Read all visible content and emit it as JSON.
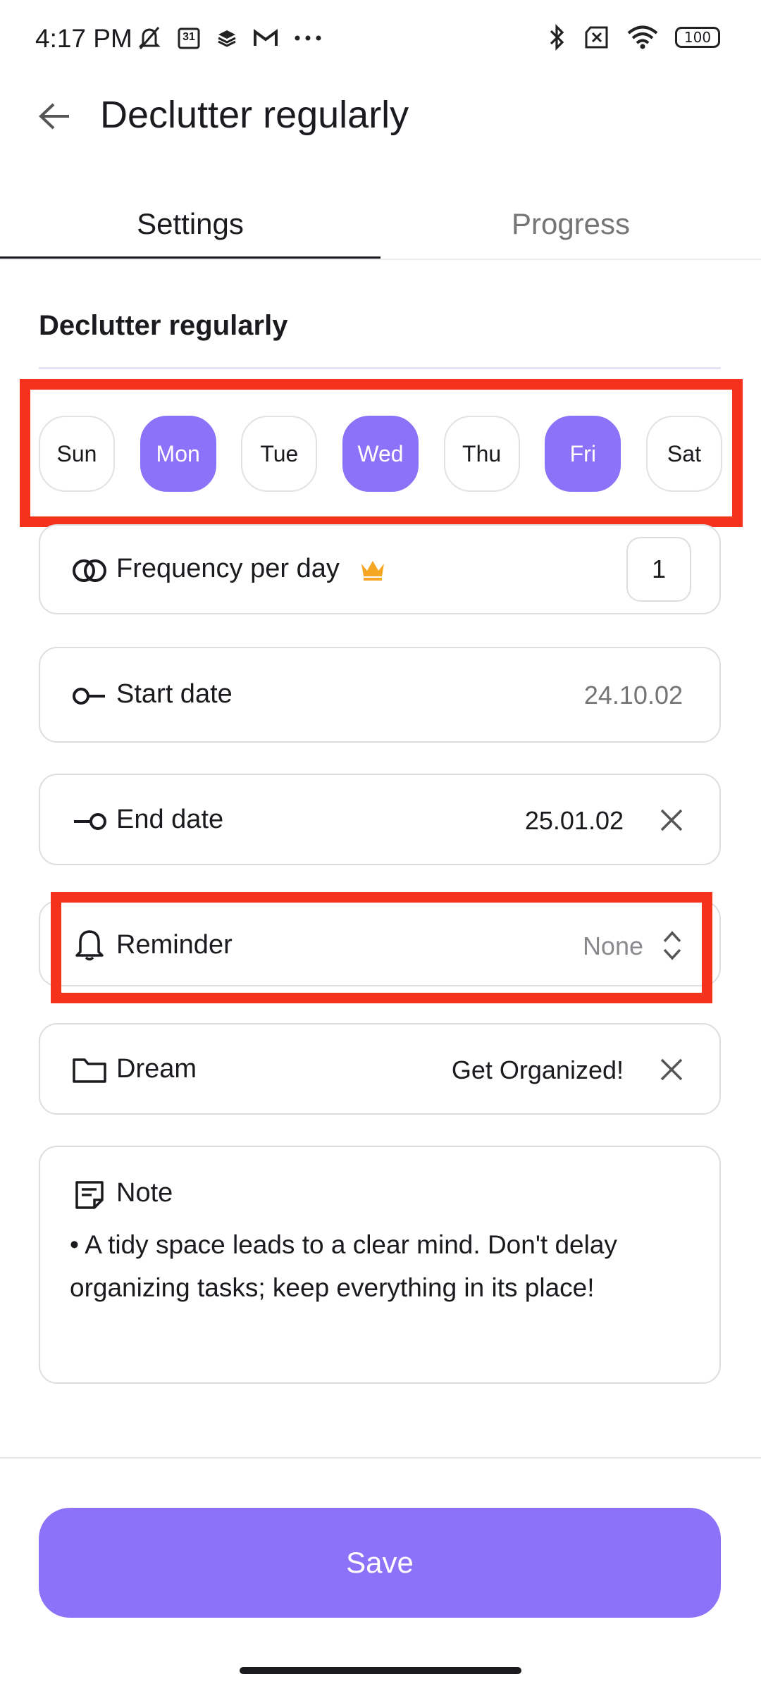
{
  "status_bar": {
    "time": "4:17 PM",
    "calendar_day": "31",
    "battery": "100"
  },
  "header": {
    "title": "Declutter regularly"
  },
  "tabs": [
    {
      "label": "Settings",
      "active": true
    },
    {
      "label": "Progress",
      "active": false
    }
  ],
  "habit": {
    "name": "Declutter regularly"
  },
  "days": [
    {
      "label": "Sun",
      "selected": false
    },
    {
      "label": "Mon",
      "selected": true
    },
    {
      "label": "Tue",
      "selected": false
    },
    {
      "label": "Wed",
      "selected": true
    },
    {
      "label": "Thu",
      "selected": false
    },
    {
      "label": "Fri",
      "selected": true
    },
    {
      "label": "Sat",
      "selected": false
    }
  ],
  "frequency": {
    "label": "Frequency per day",
    "value": "1"
  },
  "start_date": {
    "label": "Start date",
    "value": "24.10.02"
  },
  "end_date": {
    "label": "End date",
    "value": "25.01.02"
  },
  "reminder": {
    "label": "Reminder",
    "value": "None"
  },
  "dream": {
    "label": "Dream",
    "value": "Get Organized!"
  },
  "note": {
    "label": "Note",
    "text": "• A tidy space leads to a clear mind. Don't delay organizing tasks; keep everything in its place!"
  },
  "save_label": "Save",
  "colors": {
    "accent": "#8c72f8",
    "highlight": "#f5321b",
    "premium": "#f5a623"
  },
  "icons": {
    "back": "arrow-left-icon",
    "frequency": "overlap-circles-icon",
    "premium": "crown-icon",
    "start": "circle-line-start-icon",
    "end": "circle-line-end-icon",
    "reminder": "bell-icon",
    "reminder_picker": "chevron-up-down-icon",
    "dream": "folder-icon",
    "note": "note-icon",
    "clear": "close-icon"
  }
}
